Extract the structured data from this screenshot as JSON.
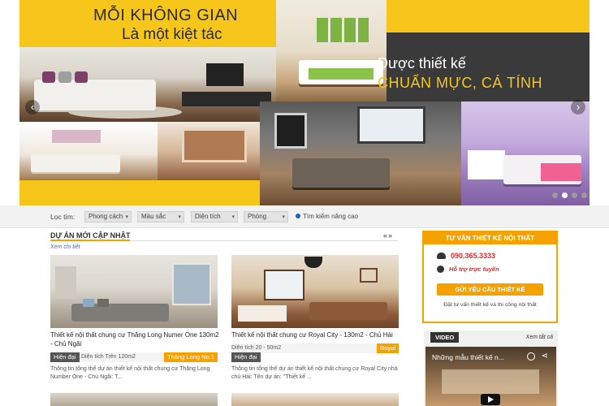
{
  "hero": {
    "headline_line1": "MỖI KHÔNG GIAN",
    "headline_line2": "Là một kiệt tác",
    "tagline_line1": "Được thiết kế",
    "tagline_line2": "CHUẨN MỰC, CÁ TÍNH",
    "prev_icon": "chevron-left-icon",
    "next_icon": "chevron-right-icon",
    "prev_glyph": "‹",
    "next_glyph": "›",
    "slide_count": 4,
    "active_slide": 1
  },
  "filter_bar": {
    "label": "Lọc tìm:",
    "selects": [
      {
        "value": "Phong cách"
      },
      {
        "value": "Màu sắc"
      },
      {
        "value": "Diện tích"
      },
      {
        "value": "Phòng"
      }
    ],
    "advanced_search": "Tìm kiếm nâng cao"
  },
  "projects": {
    "section_title": "DỰ ÁN MỚI CẬP NHẬT",
    "view_all": "Xem chi tiết",
    "nav_arrows": "«»",
    "cards": [
      {
        "title": "Thiết kế nội thất chung cư Thăng Long Numer One 130m2 - Chủ Ngãi",
        "style_badge": "Hiện đại",
        "area": "Diện tích Trên 120m2",
        "project_badge": "Thăng Long No.1",
        "description": "Thông tin tổng thể dự án thiết kế nội thất chung cư Thăng Long Number One - Chủ Ngãi: T..."
      },
      {
        "title": "Thiết kế nội thất chung cư Royal City - 130m2 - Chủ Hải",
        "style_badge": "Hiện đại",
        "area": "Diện tích 20 - 50m2",
        "project_badge": "Royal",
        "description": "Thông tin tổng thể dự án thiết kế nội thất chung cư Royal City nhà chủ Hải: Tên dự án: \"Thiết kế ..."
      }
    ]
  },
  "consult": {
    "title": "TƯ VẤN THIẾT KẾ NỘI THẤT",
    "phone": "090.365.3333",
    "support": "Hỗ trợ trực tuyến",
    "button": "GỬI YÊU CẦU THIẾT KẾ",
    "note": "Đặt tư vấn thiết kế và thi công nội thất"
  },
  "video": {
    "tab": "VIDEO",
    "view_all": "Xem tất cả",
    "title": "Những mẫu thiết kế n..."
  },
  "colors": {
    "accent": "#f5a200",
    "hero_yellow": "#f6c61a",
    "phone_red": "#d32f2f"
  }
}
